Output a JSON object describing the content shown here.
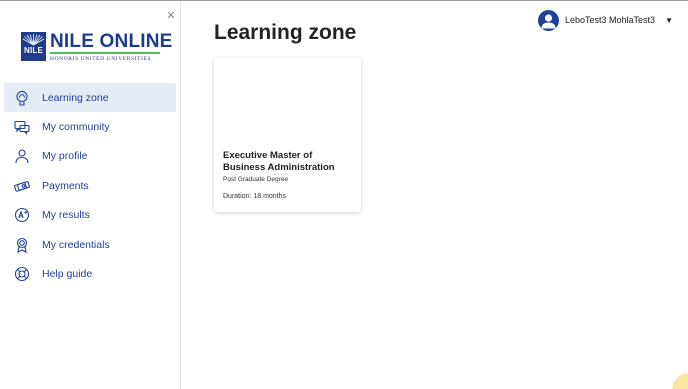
{
  "sidebar": {
    "close_glyph": "✕",
    "logo": {
      "badge_text": "NILE",
      "title": "NILE ONLINE",
      "subtitle": "HONORIS UNITED UNIVERSITIES"
    },
    "items": [
      {
        "label": "Learning zone",
        "icon": "learning-zone-icon",
        "active": true
      },
      {
        "label": "My community",
        "icon": "community-icon",
        "active": false
      },
      {
        "label": "My profile",
        "icon": "profile-icon",
        "active": false
      },
      {
        "label": "Payments",
        "icon": "payments-icon",
        "active": false
      },
      {
        "label": "My results",
        "icon": "results-icon",
        "active": false
      },
      {
        "label": "My credentials",
        "icon": "credentials-icon",
        "active": false
      },
      {
        "label": "Help guide",
        "icon": "help-icon",
        "active": false
      }
    ]
  },
  "header": {
    "user_name": "LeboTest3 MohlaTest3",
    "caret": "▼"
  },
  "main": {
    "title": "Learning zone",
    "courses": [
      {
        "title": "Executive Master of Business Administration",
        "degree": "Post Graduate Degree",
        "duration": "Duration: 18 months"
      }
    ]
  },
  "colors": {
    "brand": "#22409a",
    "active_bg": "#e6ecf5",
    "logo_rule": "#5cb85c"
  }
}
